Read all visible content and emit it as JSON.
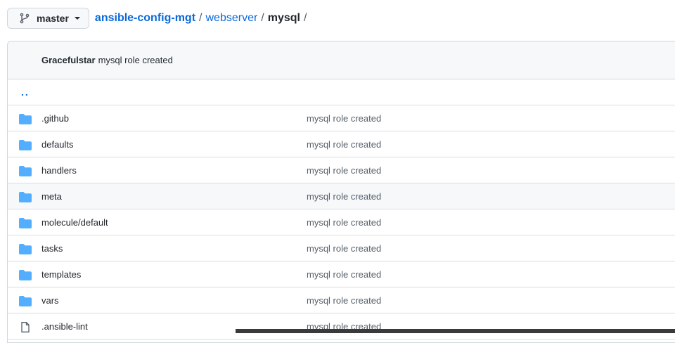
{
  "branch": {
    "name": "master"
  },
  "breadcrumb": {
    "repo": "ansible-config-mgt",
    "folder": "webserver",
    "current": "mysql",
    "separator": "/"
  },
  "commit": {
    "author": "Gracefulstar",
    "message": "mysql role created"
  },
  "parent_link": "..",
  "files": [
    {
      "name": ".github",
      "message": "mysql role created",
      "icon": "folder-icon"
    },
    {
      "name": "defaults",
      "message": "mysql role created",
      "icon": "folder-icon"
    },
    {
      "name": "handlers",
      "message": "mysql role created",
      "icon": "folder-icon"
    },
    {
      "name": "meta",
      "message": "mysql role created",
      "icon": "folder-icon"
    },
    {
      "name": "molecule/default",
      "message": "mysql role created",
      "icon": "folder-icon"
    },
    {
      "name": "tasks",
      "message": "mysql role created",
      "icon": "folder-icon"
    },
    {
      "name": "templates",
      "message": "mysql role created",
      "icon": "folder-icon"
    },
    {
      "name": "vars",
      "message": "mysql role created",
      "icon": "folder-icon"
    },
    {
      "name": ".ansible-lint",
      "message": "mysql role created",
      "icon": "file-icon"
    }
  ],
  "colors": {
    "link": "#0969da",
    "folder": "#54aeff",
    "border": "#d0d7de"
  }
}
